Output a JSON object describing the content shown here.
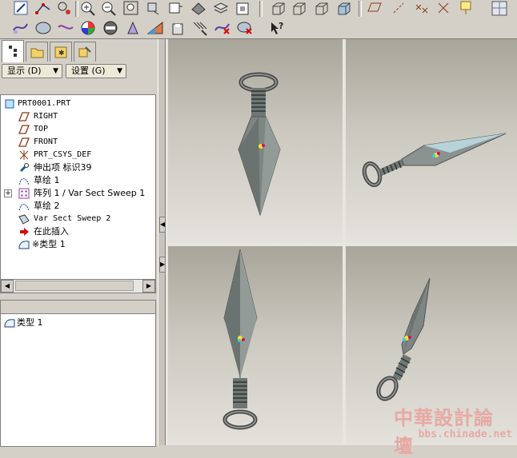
{
  "toolbar": {
    "row1_icons": [
      "sketch-icon",
      "datum-axis-icon",
      "datum-point-icon",
      "zoom-in-icon",
      "zoom-out-icon",
      "refit-icon",
      "reorient-icon",
      "view-select-icon",
      "saved-views-icon",
      "layers-icon",
      "view-manager-icon",
      "wireframe-icon",
      "hidden-line-icon",
      "no-hidden-icon",
      "shading-icon",
      "datum-plane-display-icon",
      "datum-axis-display-icon",
      "datum-point-display-icon",
      "csys-display-icon",
      "annotation-display-icon"
    ],
    "row2_icons": [
      "sweep-icon",
      "blend-icon",
      "variable-sweep-icon",
      "color-appearance-icon",
      "model-tree-settings-icon",
      "analysis-icon",
      "surface-analysis-icon",
      "save-analysis-icon",
      "hatch-icon",
      "delete-analysis-icon",
      "delete-all-icon",
      "context-help-icon"
    ]
  },
  "navigator": {
    "tabs": [
      "model-tree-tab",
      "folder-browser-tab",
      "favorites-tab",
      "connections-tab"
    ],
    "show_label": "显示 (D)",
    "settings_label": "设置 (G)"
  },
  "model_tree": {
    "items": [
      {
        "label": "PRT0001.PRT",
        "icon": "part-icon"
      },
      {
        "label": "RIGHT",
        "icon": "datum-plane-icon"
      },
      {
        "label": "TOP",
        "icon": "datum-plane-icon"
      },
      {
        "label": "FRONT",
        "icon": "datum-plane-icon"
      },
      {
        "label": "PRT_CSYS_DEF",
        "icon": "csys-icon"
      },
      {
        "label": "伸出项 标识39",
        "icon": "protrusion-icon"
      },
      {
        "label": "草绘 1",
        "icon": "sketch-icon"
      },
      {
        "label": "阵列 1 / Var Sect Sweep 1",
        "icon": "pattern-icon"
      },
      {
        "label": "草绘 2",
        "icon": "sketch-icon"
      },
      {
        "label": "Var Sect Sweep 2",
        "icon": "sweep-feature-icon"
      },
      {
        "label": "在此插入",
        "icon": "insert-here-arrow-icon"
      },
      {
        "label": "※类型 1",
        "icon": "type-icon"
      }
    ]
  },
  "layer_panel": {
    "items": [
      {
        "label": "类型 1",
        "icon": "type-icon"
      }
    ]
  },
  "viewports": [
    "front-view",
    "iso-view",
    "top-view",
    "right-view"
  ],
  "watermark": {
    "cn": "中華設計論壇",
    "url": "bbs.chinade.net"
  },
  "colors": {
    "background": "#d4d0c8",
    "model": "#7f8785",
    "viewport_top": "#a8a59a",
    "viewport_bottom": "#e4e2dc"
  }
}
